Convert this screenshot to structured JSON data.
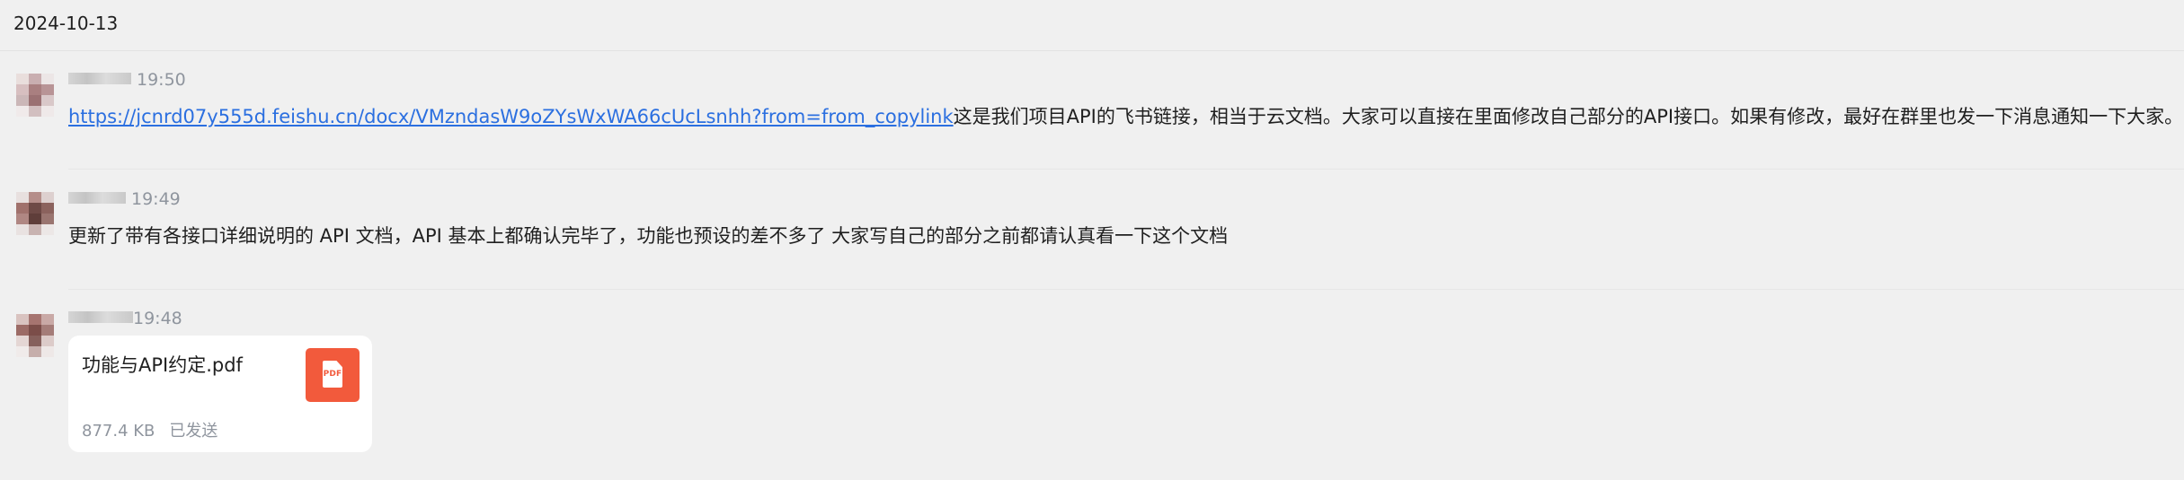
{
  "date": "2024-10-13",
  "messages": [
    {
      "time": "19:50",
      "link": "https://jcnrd07y555d.feishu.cn/docx/VMzndasW9oZYsWxWA66cUcLsnhh?from=from_copylink",
      "text": "这是我们项目API的飞书链接，相当于云文档。大家可以直接在里面修改自己部分的API接口。如果有修改，最好在群里也发一下消息通知一下大家。"
    },
    {
      "time": "19:49",
      "text": "更新了带有各接口详细说明的 API 文档，API 基本上都确认完毕了，功能也预设的差不多了 大家写自己的部分之前都请认真看一下这个文档"
    },
    {
      "time": "19:48",
      "file": {
        "name": "功能与API约定.pdf",
        "size": "877.4 KB",
        "status": "已发送",
        "icon": "pdf-file-icon",
        "icon_label": "PDF",
        "icon_color": "#f25a3c"
      }
    }
  ],
  "colors": {
    "background": "#f0f0f0",
    "link": "#2b6fe0",
    "meta": "#8f959e",
    "card": "#ffffff"
  }
}
